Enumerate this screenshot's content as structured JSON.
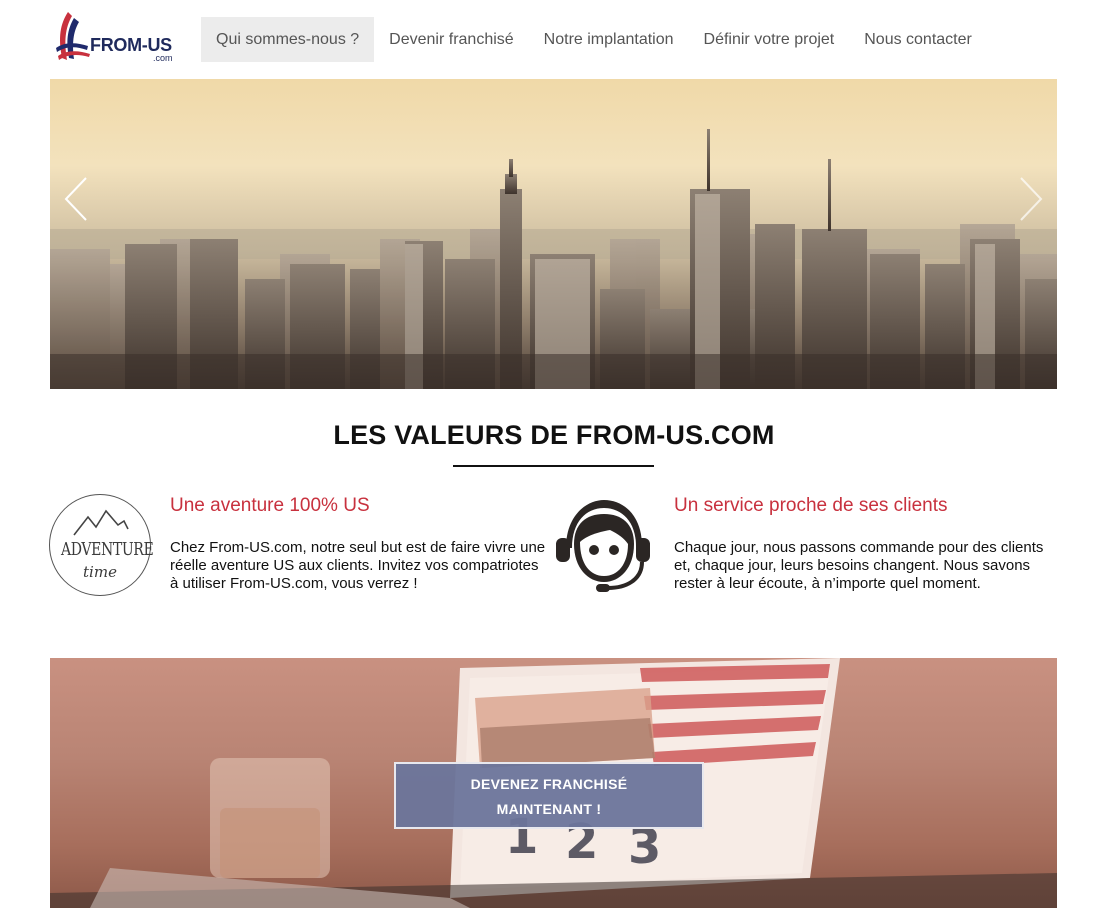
{
  "logo": {
    "name": "FROM-US",
    "sub": ".com"
  },
  "nav": [
    {
      "label": "Qui sommes-nous ?",
      "active": true
    },
    {
      "label": "Devenir franchisé",
      "active": false
    },
    {
      "label": "Notre implantation",
      "active": false
    },
    {
      "label": "Définir votre projet",
      "active": false
    },
    {
      "label": "Nous contacter",
      "active": false
    }
  ],
  "section": {
    "title": "LES VALEURS DE FROM-US.COM"
  },
  "values": [
    {
      "icon": "adventure-time-icon",
      "badge_word": "ADVENTURE",
      "badge_script": "time",
      "heading": "Une aventure 100% US",
      "text": "Chez From-US.com, notre seul but est de faire vivre une réelle aventure US aux clients. Invitez vos compatriotes à utiliser From-US.com, vous verrez !"
    },
    {
      "icon": "customer-support-headset-icon",
      "heading": "Un service proche de ses clients",
      "text": "Chaque jour, nous passons commande pour des clients et, chaque jour, leurs besoins changent. Nous savons rester à leur écoute, à n’importe quel moment."
    }
  ],
  "banner": {
    "cta_label": "DEVENEZ FRANCHISÉ MAINTENANT !"
  },
  "colors": {
    "accent_red": "#c8313e",
    "cta_blue": "#6b759b",
    "nav_active_bg": "#ececec"
  }
}
